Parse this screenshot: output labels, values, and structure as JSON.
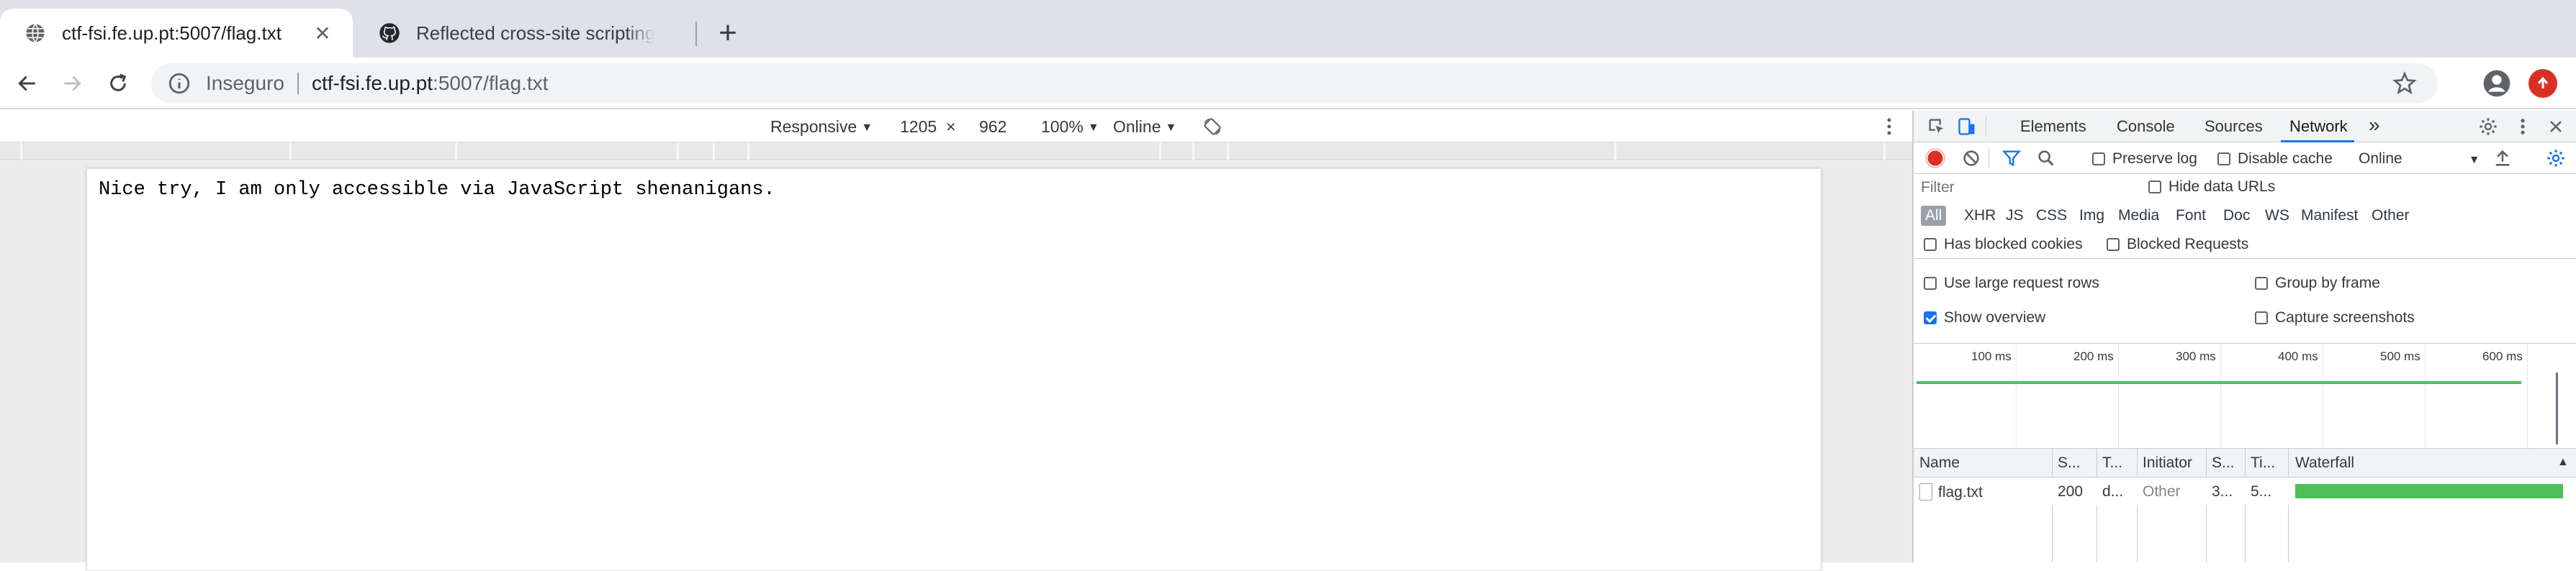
{
  "tabs": [
    {
      "title": "ctf-fsi.fe.up.pt:5007/flag.txt",
      "icon": "globe-icon",
      "active": true
    },
    {
      "title": "Reflected cross-site scripting v",
      "icon": "github-icon",
      "active": false
    }
  ],
  "omnibox": {
    "security_label": "Inseguro",
    "url_host": "ctf-fsi.fe.up.pt",
    "url_path": ":5007/flag.txt"
  },
  "device_toolbar": {
    "device": "Responsive",
    "width": "1205",
    "times": "×",
    "height": "962",
    "zoom": "100%",
    "network": "Online"
  },
  "page": {
    "text": "Nice try, I am only accessible via JavaScript shenanigans."
  },
  "devtools": {
    "tabs": [
      "Elements",
      "Console",
      "Sources",
      "Network"
    ],
    "active_tab": "Network",
    "more_tabs": "»",
    "toolbar": {
      "preserve_log": "Preserve log",
      "disable_cache": "Disable cache",
      "throttling": "Online"
    },
    "filter": {
      "placeholder": "Filter",
      "hide_data_urls": "Hide data URLs",
      "types": [
        "All",
        "XHR",
        "JS",
        "CSS",
        "Img",
        "Media",
        "Font",
        "Doc",
        "WS",
        "Manifest",
        "Other"
      ],
      "has_blocked_cookies": "Has blocked cookies",
      "blocked_requests": "Blocked Requests"
    },
    "settings": {
      "large_rows": "Use large request rows",
      "group_by_frame": "Group by frame",
      "show_overview": "Show overview",
      "capture_screenshots": "Capture screenshots"
    },
    "overview_ticks": [
      "100 ms",
      "200 ms",
      "300 ms",
      "400 ms",
      "500 ms",
      "600 ms"
    ],
    "columns": {
      "name": "Name",
      "status": "S...",
      "type": "T...",
      "initiator": "Initiator",
      "size": "S...",
      "time": "Ti...",
      "waterfall": "Waterfall"
    },
    "requests": [
      {
        "name": "flag.txt",
        "status": "200",
        "type": "d...",
        "initiator": "Other",
        "size": "3...",
        "time": "5..."
      }
    ]
  },
  "colors": {
    "record": "#d93025",
    "accent": "#1a73e8",
    "waterfall": "#4ec05a"
  }
}
